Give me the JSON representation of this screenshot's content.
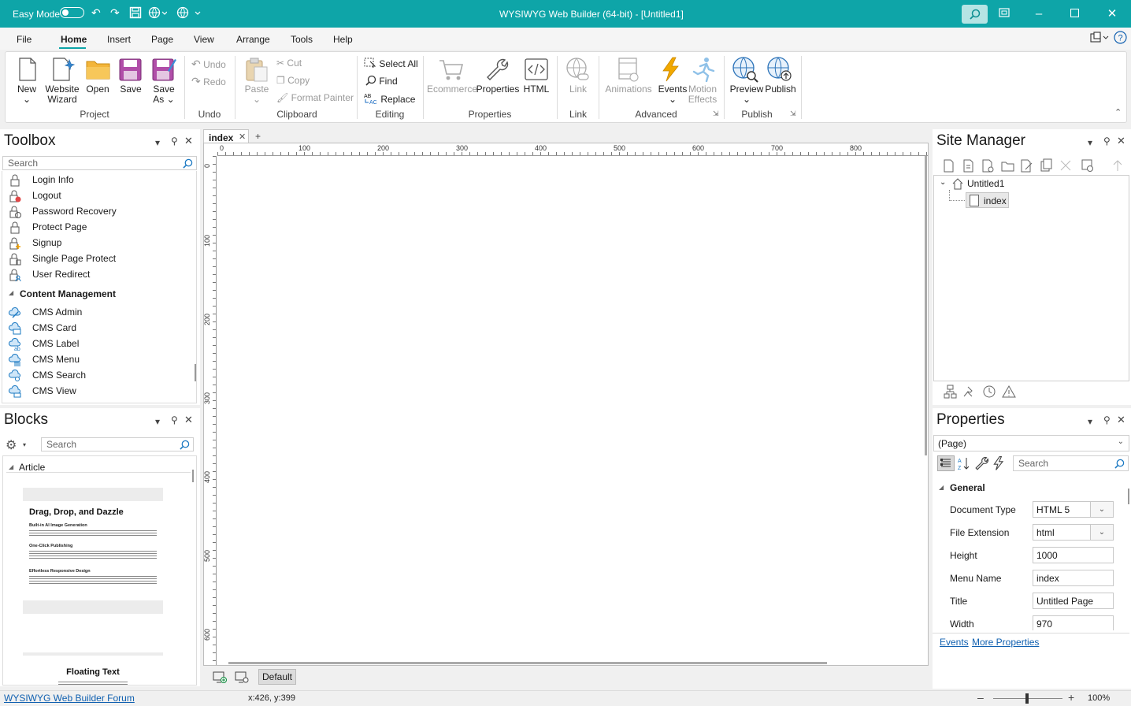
{
  "titlebar": {
    "easy_mode": "Easy Mode",
    "title": "WYSIWYG Web Builder (64-bit) - [Untitled1]"
  },
  "menu": [
    "File",
    "Home",
    "Insert",
    "Page",
    "View",
    "Arrange",
    "Tools",
    "Help"
  ],
  "ribbon": {
    "project": {
      "new": "New",
      "website": "Website",
      "wizard": "Wizard",
      "open": "Open",
      "save": "Save",
      "save_as_1": "Save",
      "save_as_2": "As",
      "label": "Project"
    },
    "undo": {
      "undo": "Undo",
      "redo": "Redo",
      "label": "Undo"
    },
    "clipboard": {
      "paste": "Paste",
      "cut": "Cut",
      "copy": "Copy",
      "format_painter": "Format Painter",
      "label": "Clipboard"
    },
    "editing": {
      "select_all": "Select All",
      "find": "Find",
      "replace": "Replace",
      "label": "Editing"
    },
    "properties": {
      "ecommerce": "Ecommerce",
      "properties": "Properties",
      "html": "HTML",
      "label": "Properties"
    },
    "link": {
      "link": "Link",
      "label": "Link"
    },
    "advanced": {
      "animations": "Animations",
      "events": "Events",
      "motion_1": "Motion",
      "motion_2": "Effects",
      "label": "Advanced"
    },
    "publish": {
      "preview": "Preview",
      "publish": "Publish",
      "label": "Publish"
    }
  },
  "toolbox": {
    "title": "Toolbox",
    "search_placeholder": "Search",
    "items": [
      "Login Info",
      "Logout",
      "Password Recovery",
      "Protect Page",
      "Signup",
      "Single Page Protect",
      "User Redirect"
    ],
    "section": "Content Management",
    "cms_items": [
      "CMS Admin",
      "CMS Card",
      "CMS Label",
      "CMS Menu",
      "CMS Search",
      "CMS View"
    ]
  },
  "blocks": {
    "title": "Blocks",
    "search_placeholder": "Search",
    "section": "Article",
    "preview1": {
      "heading": "Drag, Drop, and Dazzle",
      "sub1": "Built-in AI Image Generation",
      "sub2": "One-Click Publishing",
      "sub3": "Effortless Responsive Design"
    },
    "preview2": {
      "heading": "Floating Text"
    }
  },
  "editor": {
    "tab": "index",
    "add_tab": "+",
    "hruler": [
      "0",
      "100",
      "200",
      "300",
      "400",
      "500",
      "600",
      "700",
      "800"
    ],
    "vruler": [
      "0",
      "100",
      "200",
      "300",
      "400",
      "500",
      "600"
    ],
    "default_btn": "Default"
  },
  "site_manager": {
    "title": "Site Manager",
    "root": "Untitled1",
    "page": "index"
  },
  "properties": {
    "title": "Properties",
    "selector": "(Page)",
    "search_placeholder": "Search",
    "section": "General",
    "rows": [
      {
        "label": "Document Type",
        "value": "HTML 5"
      },
      {
        "label": "File Extension",
        "value": "html"
      },
      {
        "label": "Height",
        "value": "1000"
      },
      {
        "label": "Menu Name",
        "value": "index"
      },
      {
        "label": "Title",
        "value": "Untitled Page"
      },
      {
        "label": "Width",
        "value": "970"
      }
    ],
    "link_events": "Events",
    "link_more": "More Properties"
  },
  "status": {
    "forum": "WYSIWYG Web Builder Forum",
    "coords": "x:426, y:399",
    "zoom": "100%"
  },
  "colors": {
    "accent": "#0ea5a8"
  }
}
